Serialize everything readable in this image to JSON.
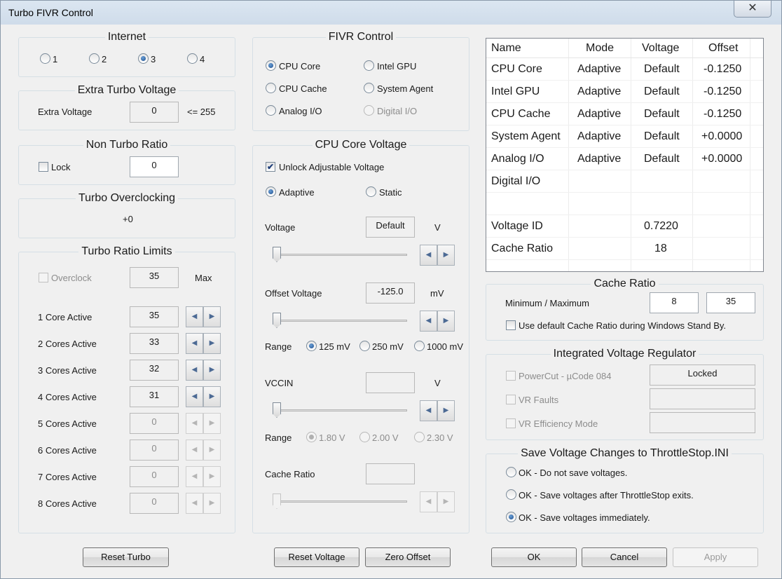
{
  "window": {
    "title": "Turbo FIVR Control",
    "close_glyph": "✕"
  },
  "internet": {
    "title": "Internet",
    "options": [
      "1",
      "2",
      "3",
      "4"
    ],
    "selected": "3"
  },
  "extra_turbo": {
    "title": "Extra Turbo Voltage",
    "label": "Extra Voltage",
    "value": "0",
    "limit": "<= 255"
  },
  "non_turbo": {
    "title": "Non Turbo Ratio",
    "lock_label": "Lock",
    "lock_checked": false,
    "value": "0"
  },
  "turbo_oc": {
    "title": "Turbo Overclocking",
    "value": "+0"
  },
  "ratio_limits": {
    "title": "Turbo Ratio Limits",
    "overclock_label": "Overclock",
    "overclock_checked": false,
    "max_value": "35",
    "max_label": "Max",
    "rows": [
      {
        "label": "1 Core Active",
        "value": "35",
        "enabled": true
      },
      {
        "label": "2 Cores Active",
        "value": "33",
        "enabled": true
      },
      {
        "label": "3 Cores Active",
        "value": "32",
        "enabled": true
      },
      {
        "label": "4 Cores Active",
        "value": "31",
        "enabled": true
      },
      {
        "label": "5 Cores Active",
        "value": "0",
        "enabled": false
      },
      {
        "label": "6 Cores Active",
        "value": "0",
        "enabled": false
      },
      {
        "label": "7 Cores Active",
        "value": "0",
        "enabled": false
      },
      {
        "label": "8 Cores Active",
        "value": "0",
        "enabled": false
      }
    ]
  },
  "fivr": {
    "title": "FIVR Control",
    "options": [
      "CPU Core",
      "Intel GPU",
      "CPU Cache",
      "System Agent",
      "Analog I/O",
      "Digital I/O"
    ],
    "selected": "CPU Core",
    "disabled": [
      "Digital I/O"
    ]
  },
  "core_voltage": {
    "title": "CPU Core Voltage",
    "unlock_label": "Unlock Adjustable Voltage",
    "unlock_checked": true,
    "mode_options": [
      "Adaptive",
      "Static"
    ],
    "mode_selected": "Adaptive",
    "voltage_label": "Voltage",
    "voltage_value": "Default",
    "voltage_unit": "V",
    "offset_label": "Offset Voltage",
    "offset_value": "-125.0",
    "offset_unit": "mV",
    "range_label": "Range",
    "range_options": [
      "125 mV",
      "250 mV",
      "1000 mV"
    ],
    "range_selected": "125 mV",
    "vccin_label": "VCCIN",
    "vccin_value": "",
    "vccin_unit": "V",
    "vccin_range_label": "Range",
    "vccin_range_options": [
      "1.80 V",
      "2.00 V",
      "2.30 V"
    ],
    "vccin_range_selected": "1.80 V",
    "cache_label": "Cache Ratio",
    "cache_value": ""
  },
  "voltage_table": {
    "headers": [
      "Name",
      "Mode",
      "Voltage",
      "Offset"
    ],
    "rows": [
      [
        "CPU Core",
        "Adaptive",
        "Default",
        "-0.1250"
      ],
      [
        "Intel GPU",
        "Adaptive",
        "Default",
        "-0.1250"
      ],
      [
        "CPU Cache",
        "Adaptive",
        "Default",
        "-0.1250"
      ],
      [
        "System Agent",
        "Adaptive",
        "Default",
        "+0.0000"
      ],
      [
        "Analog I/O",
        "Adaptive",
        "Default",
        "+0.0000"
      ],
      [
        "Digital I/O",
        "",
        "",
        ""
      ],
      [
        "",
        "",
        "",
        ""
      ],
      [
        "Voltage ID",
        "",
        "0.7220",
        ""
      ],
      [
        "Cache Ratio",
        "",
        "18",
        ""
      ]
    ]
  },
  "cache_ratio": {
    "title": "Cache Ratio",
    "label": "Minimum / Maximum",
    "min": "8",
    "max": "35",
    "standby_label": "Use default Cache Ratio during Windows Stand By.",
    "standby_checked": false
  },
  "ivr": {
    "title": "Integrated Voltage Regulator",
    "powercut_label": "PowerCut  -  µCode 084",
    "powercut_status": "Locked",
    "vr_faults_label": "VR Faults",
    "vr_efficiency_label": "VR Efficiency Mode"
  },
  "save": {
    "title": "Save Voltage Changes to ThrottleStop.INI",
    "options": [
      "OK - Do not save voltages.",
      "OK - Save voltages after ThrottleStop exits.",
      "OK - Save voltages immediately."
    ],
    "selected": "OK - Save voltages immediately."
  },
  "buttons": {
    "reset_turbo": "Reset Turbo",
    "reset_voltage": "Reset Voltage",
    "zero_offset": "Zero Offset",
    "ok": "OK",
    "cancel": "Cancel",
    "apply": "Apply"
  }
}
